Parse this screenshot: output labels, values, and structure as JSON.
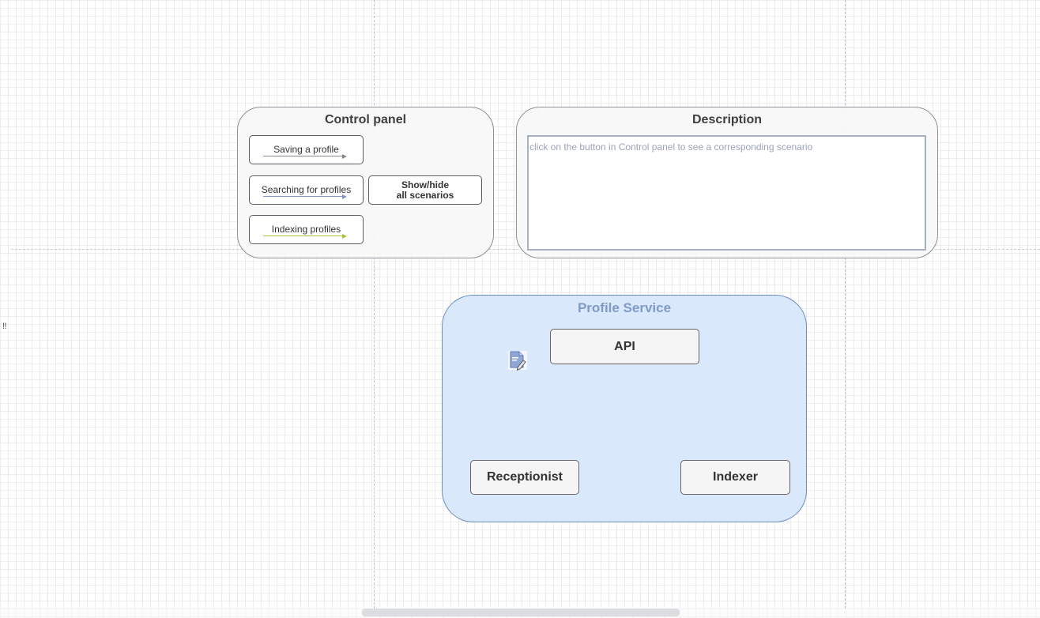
{
  "control_panel": {
    "title": "Control panel",
    "buttons": [
      {
        "label": "Saving a profile",
        "arrow_color": "#888888"
      },
      {
        "label": "Searching for profiles",
        "arrow_color": "#8a92c4"
      },
      {
        "label": "Indexing profiles",
        "arrow_color": "#a8c23a"
      }
    ],
    "show_hide_line1": "Show/hide",
    "show_hide_line2": "all scenarios"
  },
  "description": {
    "title": "Description",
    "text": "click on the button in Control panel to see a corresponding scenario"
  },
  "service": {
    "title": "Profile Service",
    "nodes": {
      "api": "API",
      "receptionist": "Receptionist",
      "indexer": "Indexer"
    },
    "fill": "#dae8fc",
    "stroke": "#6c8ebf"
  },
  "misc": {
    "left_mark": "‼",
    "doc_icon": "document-edit-icon"
  }
}
